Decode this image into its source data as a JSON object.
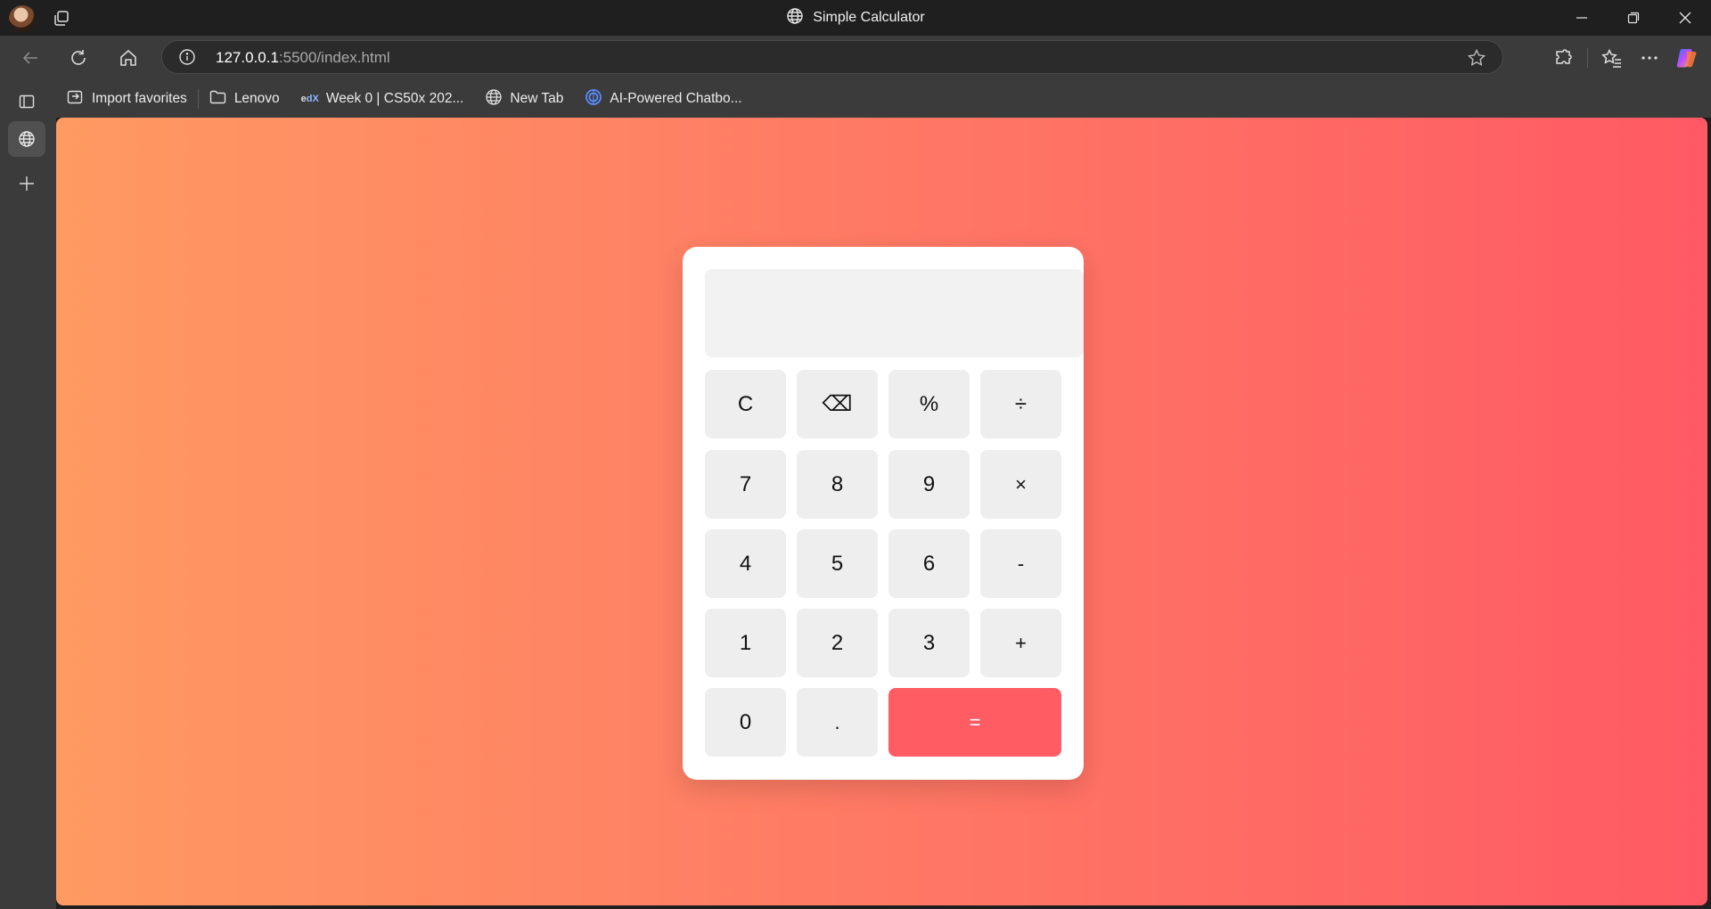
{
  "window": {
    "title": "Simple Calculator"
  },
  "address_bar": {
    "host": "127.0.0.1",
    "path": ":5500/index.html"
  },
  "favorites": [
    {
      "label": "Import favorites",
      "icon": "import-icon"
    },
    {
      "label": "Lenovo",
      "icon": "folder-icon"
    },
    {
      "label": "Week 0 | CS50x 202...",
      "icon": "edx-icon"
    },
    {
      "label": "New Tab",
      "icon": "globe-icon"
    },
    {
      "label": "AI-Powered Chatbo...",
      "icon": "chatbot-icon"
    }
  ],
  "calculator": {
    "display_value": "",
    "keys": {
      "clear": "C",
      "backspace": "⌫",
      "percent": "%",
      "divide": "÷",
      "seven": "7",
      "eight": "8",
      "nine": "9",
      "multiply": "×",
      "four": "4",
      "five": "5",
      "six": "6",
      "minus": "-",
      "one": "1",
      "two": "2",
      "three": "3",
      "plus": "+",
      "zero": "0",
      "decimal": ".",
      "equals": "="
    }
  },
  "colors": {
    "gradient_start": "#ff9a62",
    "gradient_end": "#ff5a64",
    "equals_button": "#ff5c64",
    "key_background": "#eeeeee"
  }
}
